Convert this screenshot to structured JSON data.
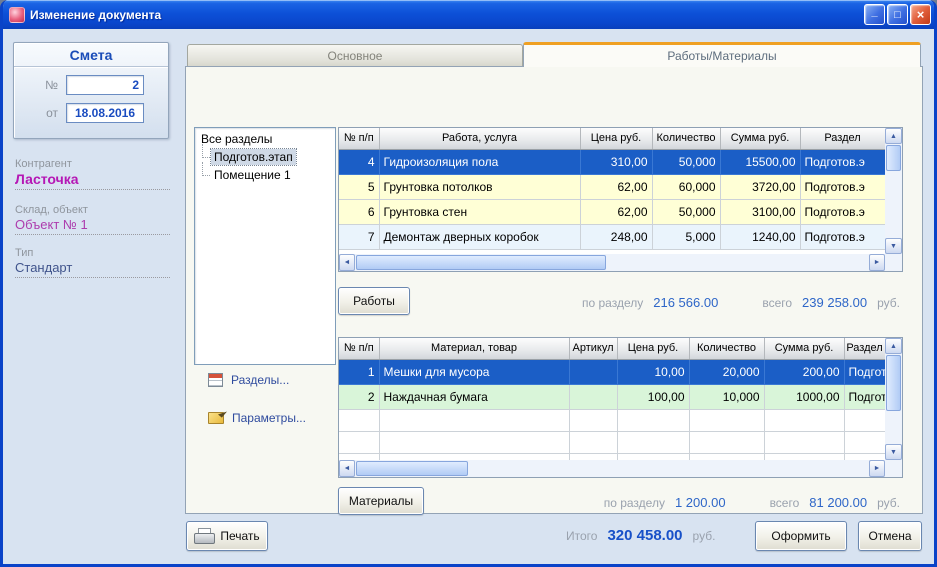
{
  "window": {
    "title": "Изменение документа"
  },
  "icons": {
    "app": "document",
    "minimize": "_",
    "maximize": "□",
    "close": "×",
    "arrow_up": "▲",
    "arrow_down": "▼",
    "arrow_left": "◄",
    "arrow_right": "►",
    "printer": "printer-shape",
    "sections": "table-grid",
    "params": "pencil"
  },
  "estimate": {
    "title": "Смета",
    "number_label": "№",
    "number_value": "2",
    "date_label": "от",
    "date_value": "18.08.2016"
  },
  "info": {
    "contractor_label": "Контрагент",
    "contractor_value": "Ласточка",
    "object_label": "Склад, объект",
    "object_value": "Объект № 1",
    "type_label": "Тип",
    "type_value": "Стандарт"
  },
  "tabs": [
    {
      "label": "Основное",
      "active": false
    },
    {
      "label": "Работы/Материалы",
      "active": true
    }
  ],
  "tree": {
    "root": "Все разделы",
    "items": [
      {
        "label": "Подготов.этап",
        "selected": true
      },
      {
        "label": "Помещение 1",
        "selected": false
      }
    ]
  },
  "actions": {
    "sections_label": "Разделы...",
    "params_label": "Параметры..."
  },
  "works": {
    "headers": [
      "№ п/п",
      "Работа, услуга",
      "Цена руб.",
      "Количество",
      "Сумма руб.",
      "Раздел"
    ],
    "rows": [
      {
        "num": "4",
        "name": "Гидроизоляция пола",
        "price": "310,00",
        "qty": "50,000",
        "sum": "15500,00",
        "section": "Подготов.э"
      },
      {
        "num": "5",
        "name": "Грунтовка потолков",
        "price": "62,00",
        "qty": "60,000",
        "sum": "3720,00",
        "section": "Подготов.э"
      },
      {
        "num": "6",
        "name": "Грунтовка стен",
        "price": "62,00",
        "qty": "50,000",
        "sum": "3100,00",
        "section": "Подготов.э"
      },
      {
        "num": "7",
        "name": "Демонтаж дверных коробок",
        "price": "248,00",
        "qty": "5,000",
        "sum": "1240,00",
        "section": "Подготов.э"
      }
    ],
    "button_label": "Работы",
    "section_total_label": "по разделу",
    "section_total_value": "216 566.00",
    "grand_total_label": "всего",
    "grand_total_value": "239 258.00",
    "currency": "руб."
  },
  "materials": {
    "headers": [
      "№ п/п",
      "Материал, товар",
      "Артикул",
      "Цена руб.",
      "Количество",
      "Сумма руб.",
      "Раздел"
    ],
    "rows": [
      {
        "num": "1",
        "name": "Мешки для мусора",
        "article": "",
        "price": "10,00",
        "qty": "20,000",
        "sum": "200,00",
        "section": "Подгот"
      },
      {
        "num": "2",
        "name": "Наждачная бумага",
        "article": "",
        "price": "100,00",
        "qty": "10,000",
        "sum": "1000,00",
        "section": "Подгот"
      }
    ],
    "button_label": "Материалы",
    "section_total_label": "по разделу",
    "section_total_value": "1 200.00",
    "grand_total_label": "всего",
    "grand_total_value": "81 200.00",
    "currency": "руб."
  },
  "footer": {
    "print_label": "Печать",
    "total_label": "Итого",
    "total_value": "320 458.00",
    "currency": "руб.",
    "submit_label": "Оформить",
    "cancel_label": "Отмена"
  },
  "colors": {
    "title_bar_blue": "#0d51d8",
    "selected_row": "#1b5ec6",
    "works_row_yellow": "#ffffd6",
    "materials_row_green": "#d9f5d9",
    "tab_accent_orange": "#efa023",
    "value_blue": "#2e66c8",
    "contractor_magenta": "#b517b5"
  }
}
